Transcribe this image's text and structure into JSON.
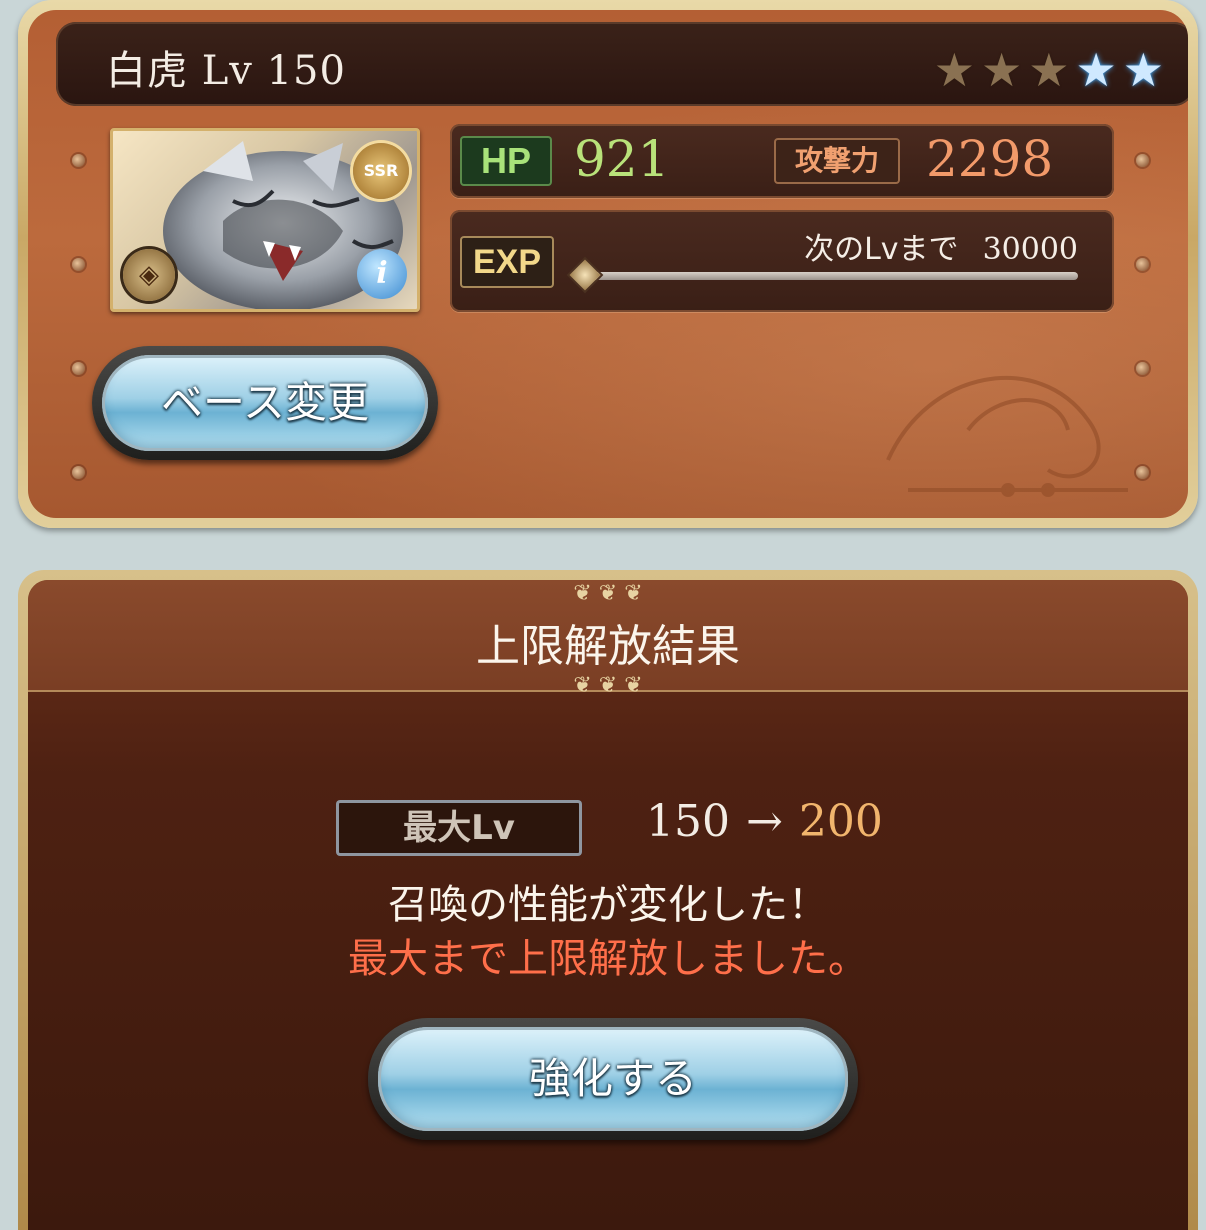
{
  "summon": {
    "title": "白虎 Lv 150",
    "rarity": "SSR",
    "stars": [
      "bronze",
      "bronze",
      "bronze",
      "blue",
      "blue"
    ]
  },
  "stats": {
    "hp_label": "HP",
    "hp_value": "921",
    "atk_label": "攻撃力",
    "atk_value": "2298",
    "exp_label": "EXP",
    "next_level_label": "次のLvまで",
    "next_level_value": "30000",
    "exp_progress": 0.0
  },
  "buttons": {
    "change_base": "ベース変更",
    "enhance": "強化する"
  },
  "result": {
    "title": "上限解放結果",
    "max_lv_label": "最大Lv",
    "lv_from": "150",
    "arrow": "→",
    "lv_to": "200",
    "message": "召喚の性能が変化した！",
    "message_highlight": "最大まで上限解放しました。"
  },
  "colors": {
    "hp_value": "#b9e27a",
    "atk_value": "#f29a6a",
    "lv_to": "#f1b56d",
    "highlight": "#ff6f4a"
  }
}
